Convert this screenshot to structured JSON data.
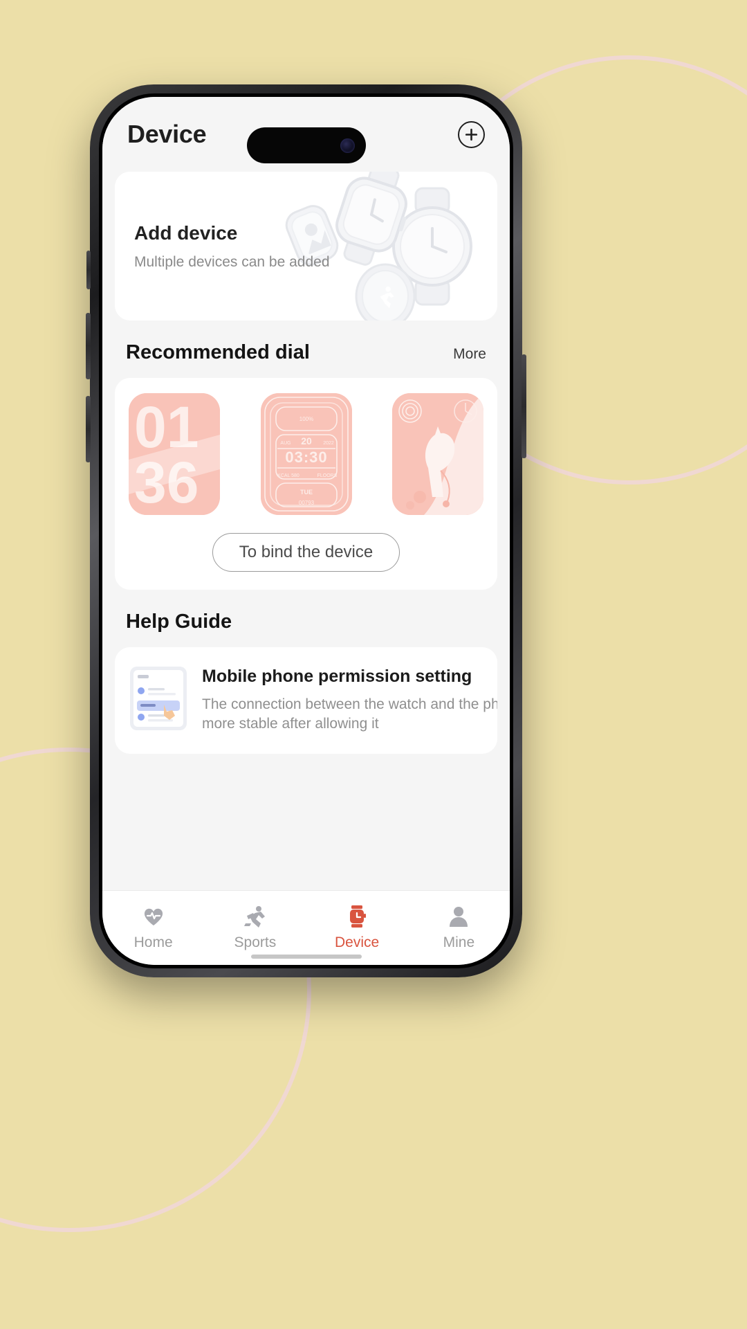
{
  "header": {
    "title": "Device",
    "add_button_icon": "plus-circle-icon",
    "add_button_label": "Add"
  },
  "add_device_card": {
    "title": "Add device",
    "subtitle": "Multiple devices can be added",
    "illustration": "smartwatch-collection-illustration"
  },
  "recommended_dial": {
    "section_title": "Recommended dial",
    "more_label": "More",
    "bind_button_label": "To bind the device",
    "dials": [
      {
        "name": "big-numerals-dial",
        "top_text": "01",
        "bottom_text": "36",
        "color": "#f9c3b8"
      },
      {
        "name": "digital-module-dial",
        "time": "03:30",
        "day_number": "20",
        "month": "AUG",
        "year": "2022",
        "kcal": "KCAL 580",
        "floors": "FLOORS",
        "weekday": "TUE",
        "steps": "00793",
        "battery": "100%",
        "color": "#f9c3b8"
      },
      {
        "name": "horse-analog-dial",
        "motif": "horse",
        "color": "#f9c3b8"
      }
    ]
  },
  "help_guide": {
    "section_title": "Help Guide",
    "items": [
      {
        "icon": "permission-screen-thumbnail",
        "title": "Mobile phone permission setting",
        "description_line1": "The connection between the watch and the ph",
        "description_line2": "more stable after allowing it"
      }
    ]
  },
  "tabbar": {
    "active_color": "#d9543f",
    "inactive_color": "#9b9b9b",
    "tabs": [
      {
        "label": "Home",
        "icon": "heart-pulse-icon",
        "active": false
      },
      {
        "label": "Sports",
        "icon": "runner-icon",
        "active": false
      },
      {
        "label": "Device",
        "icon": "smartwatch-icon",
        "active": true
      },
      {
        "label": "Mine",
        "icon": "person-icon",
        "active": false
      }
    ]
  },
  "theme": {
    "background": "#ecdfa8",
    "screen_background": "#f5f5f5",
    "card_background": "#ffffff",
    "accent": "#d9543f",
    "dial_pink": "#f9c3b8"
  }
}
